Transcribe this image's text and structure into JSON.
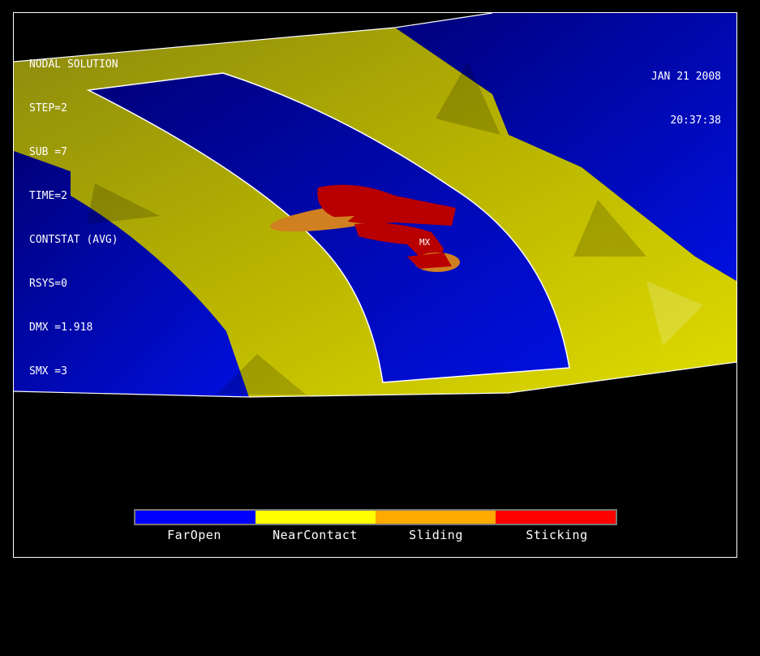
{
  "header": {
    "title": "NODAL SOLUTION",
    "lines": [
      "STEP=2",
      "SUB =7",
      "TIME=2",
      "CONTSTAT (AVG)",
      "RSYS=0",
      "DMX =1.918",
      "SMX =3"
    ],
    "date": "JAN 21 2008",
    "time": "20:37:38"
  },
  "marker": {
    "label": "MX"
  },
  "legend": {
    "items": [
      {
        "label": "FarOpen",
        "color": "#0000ff"
      },
      {
        "label": "NearContact",
        "color": "#ffff00"
      },
      {
        "label": "Sliding",
        "color": "#ffaa00"
      },
      {
        "label": "Sticking",
        "color": "#ff0000"
      }
    ]
  },
  "colors": {
    "background": "#000000",
    "far_open_region": "#0a10c8",
    "near_contact_region": "#c8c800",
    "sticking_region": "#b80000",
    "sliding_region": "#d08020"
  }
}
